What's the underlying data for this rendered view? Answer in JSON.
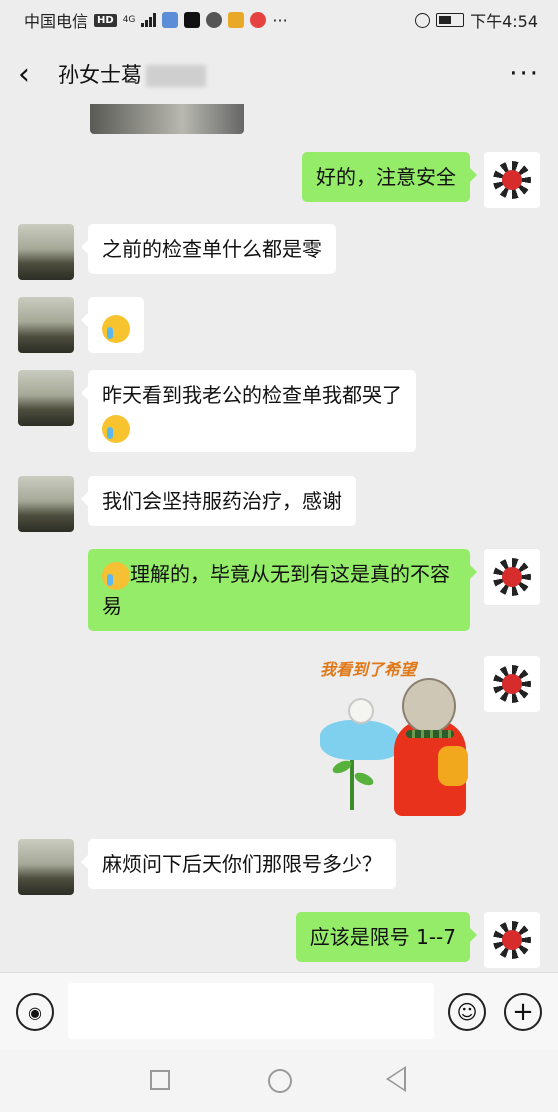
{
  "status_bar": {
    "carrier": "中国电信",
    "network_badge": "HD",
    "network_type": "4G",
    "time": "下午4:54",
    "dots": "···"
  },
  "header": {
    "back_icon": "‹",
    "contact_name": "孙女士葛",
    "more_icon": "···"
  },
  "messages": [
    {
      "side": "self",
      "text": "好的，注意安全"
    },
    {
      "side": "other",
      "text": "之前的检查单什么都是零"
    },
    {
      "side": "other",
      "text": "",
      "emoji": "loudly-crying-emoji"
    },
    {
      "side": "other",
      "text": "昨天看到我老公的检查单我都哭了",
      "emoji": "crying-laughing-emoji"
    },
    {
      "side": "other",
      "text": "我们会坚持服药治疗，感谢"
    },
    {
      "side": "self",
      "text": "理解的，毕竟从无到有这是真的不容易",
      "emoji": "hugging-emoji"
    },
    {
      "side": "self",
      "sticker_text": "我看到了希望"
    },
    {
      "side": "other",
      "text": "麻烦问下后天你们那限号多少？"
    },
    {
      "side": "self",
      "text": "应该是限号 1--7"
    }
  ],
  "input_bar": {
    "voice_icon": "voice-icon",
    "emoji_icon": "emoji-icon",
    "plus_icon": "plus-icon",
    "placeholder": ""
  },
  "system_nav": {
    "recent_icon": "square-icon",
    "home_icon": "circle-icon",
    "back_icon": "triangle-back-icon"
  }
}
